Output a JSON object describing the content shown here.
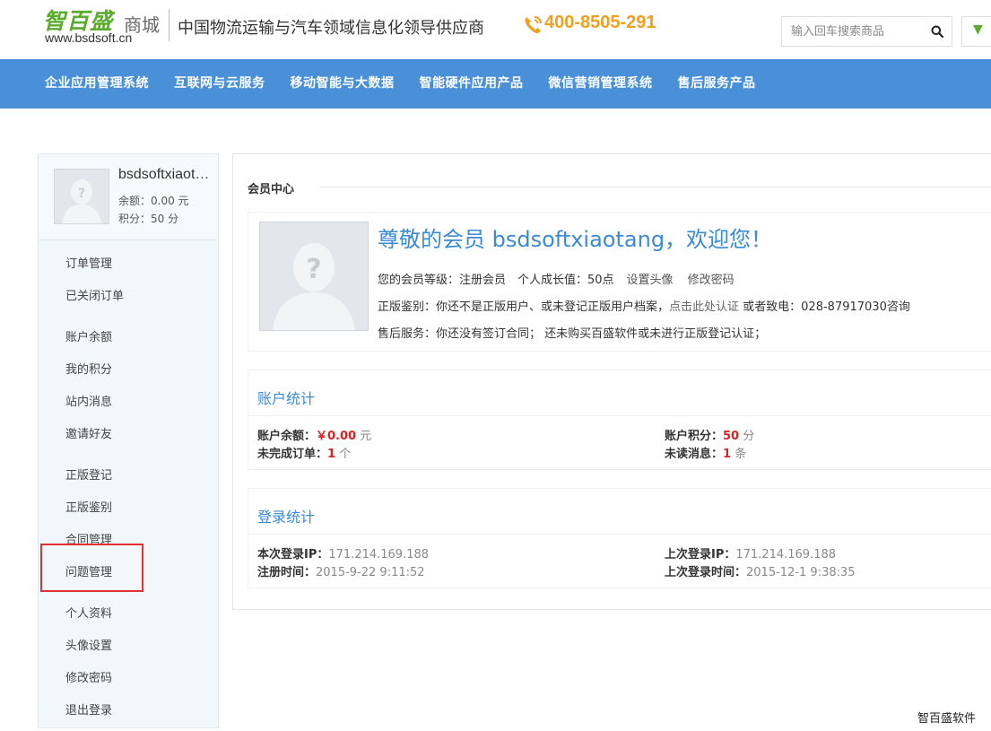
{
  "header": {
    "logo_main": "智百盛",
    "logo_sub": "商城",
    "logo_url": "www.bsdsoft.cn",
    "slogan": "中国物流运输与汽车领域信息化领导供应商",
    "phone": "400-8505-291",
    "search_placeholder": "输入回车搜索商品",
    "phone_color": "#f0a020",
    "brand_color": "#5aab2e"
  },
  "nav": {
    "background": "#4a90d9",
    "items": [
      {
        "label": "企业应用管理系统"
      },
      {
        "label": "互联网与云服务"
      },
      {
        "label": "移动智能与大数据"
      },
      {
        "label": "智能硬件应用产品"
      },
      {
        "label": "微信营销管理系统"
      },
      {
        "label": "售后服务产品"
      }
    ]
  },
  "sidebar": {
    "profile": {
      "name": "bsdsoftxiaotang",
      "balance": "余额：0.00 元",
      "points": "积分：50 分"
    },
    "menu": [
      {
        "label": "订单管理"
      },
      {
        "label": "已关闭订单"
      },
      {
        "label": "账户余额"
      },
      {
        "label": "我的积分"
      },
      {
        "label": "站内消息"
      },
      {
        "label": "邀请好友"
      },
      {
        "label": "正版登记"
      },
      {
        "label": "正版鉴别"
      },
      {
        "label": "合同管理"
      },
      {
        "label": "问题管理"
      },
      {
        "label": "个人资料"
      },
      {
        "label": "头像设置"
      },
      {
        "label": "修改密码"
      },
      {
        "label": "退出登录"
      }
    ],
    "highlighted_item": "问题管理"
  },
  "main": {
    "title": "会员中心",
    "welcome": "尊敬的会员 bsdsoftxiaotang，欢迎您！",
    "level_line": "您的会员等级：注册会员　个人成长值：50点",
    "set_avatar": "设置头像",
    "change_password": "修改密码",
    "certify_prefix": "正版鉴别：你还不是正版用户、或未登记正版用户档案，",
    "certify_link": "点击此处认证",
    "certify_suffix": " 或者致电：028-87917030咨询",
    "service_line": "售后服务：你还没有签订合同； 还未购买百盛软件或未进行正版登记认证；",
    "account_stats": {
      "title": "账户统计",
      "balance_label": "账户余额：",
      "balance_value": "￥0.00",
      "balance_unit": " 元",
      "orders_label": "未完成订单：",
      "orders_value": "1",
      "orders_unit": " 个",
      "points_label": "账户积分：",
      "points_value": "50",
      "points_unit": " 分",
      "messages_label": "未读消息：",
      "messages_value": "1",
      "messages_unit": " 条"
    },
    "login_stats": {
      "title": "登录统计",
      "this_ip_label": "本次登录IP：",
      "this_ip_value": "171.214.169.188",
      "register_label": "注册时间：",
      "register_value": "2015-9-22 9:11:52",
      "last_ip_label": "上次登录IP：",
      "last_ip_value": "171.214.169.188",
      "last_login_label": "上次登录时间：",
      "last_login_value": "2015-12-1 9:38:35"
    }
  },
  "watermark": "智百盛软件"
}
